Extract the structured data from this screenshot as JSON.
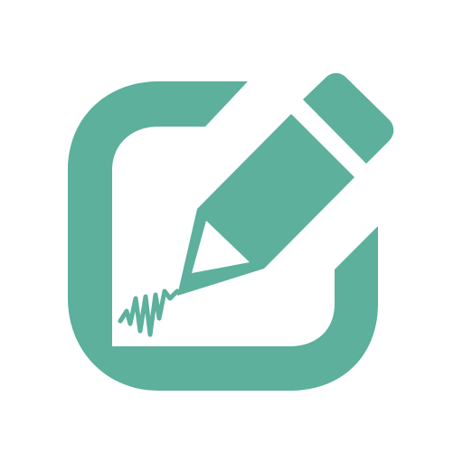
{
  "icon": {
    "name": "edit-document-icon",
    "accent_color": "#5CB09C",
    "background_color": "#FFFFFF"
  }
}
